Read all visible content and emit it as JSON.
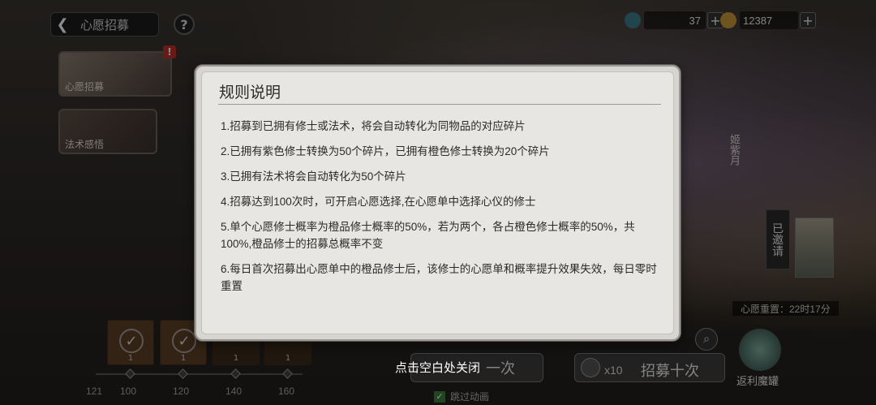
{
  "header": {
    "back_icon": "chevron-left-icon",
    "title": "心愿招募",
    "help_icon": "question-icon"
  },
  "sidebar": {
    "tabs": [
      {
        "label": "心愿招募",
        "badge": "!"
      },
      {
        "label": "法术感悟"
      }
    ]
  },
  "currency": [
    {
      "icon": "gem-icon",
      "value": "37"
    },
    {
      "icon": "coin-icon",
      "value": "12387"
    }
  ],
  "right_panel": {
    "char_name": "姬紫月",
    "invited_label": "已邀请",
    "wish_reset": "心愿重置：22时17分",
    "rebate_label": "返利魔罐"
  },
  "progress": {
    "slots": [
      {
        "count": "1",
        "claimed": true
      },
      {
        "count": "1",
        "claimed": true
      },
      {
        "count": "1",
        "claimed": false
      },
      {
        "count": "1",
        "claimed": false
      }
    ],
    "ticks": [
      "121",
      "100",
      "120",
      "140",
      "160"
    ]
  },
  "actions": {
    "recruit_one": "一次",
    "recruit_ten_multiplier": "x10",
    "recruit_ten": "招募十次",
    "skip_animation": "跳过动画",
    "close_hint": "点击空白处关闭"
  },
  "dialog": {
    "title": "规则说明",
    "rules": [
      "1.招募到已拥有修士或法术，将会自动转化为同物品的对应碎片",
      "2.已拥有紫色修士转换为50个碎片，已拥有橙色修士转换为20个碎片",
      "3.已拥有法术将会自动转化为50个碎片",
      "4.招募达到100次时，可开启心愿选择,在心愿单中选择心仪的修士",
      "5.单个心愿修士概率为橙品修士概率的50%，若为两个，各占橙色修士概率的50%，共100%,橙品修士的招募总概率不变",
      "6.每日首次招募出心愿单中的橙品修士后，该修士的心愿单和概率提升效果失效，每日零时重置"
    ]
  }
}
